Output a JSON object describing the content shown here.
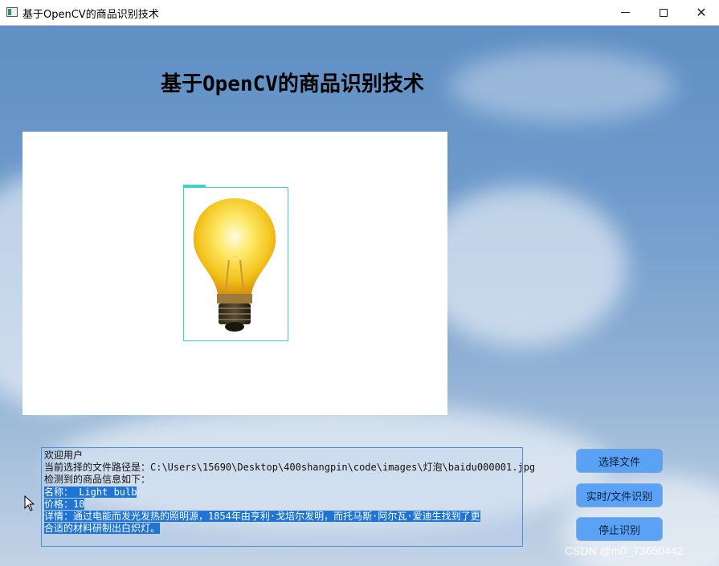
{
  "window": {
    "title": "基于OpenCV的商品识别技术",
    "minimize_label": "",
    "maximize_label": "",
    "close_label": "✕"
  },
  "page": {
    "heading": "基于OpenCV的商品识别技术"
  },
  "detection": {
    "label": "Light bulb",
    "box_color": "#3fd3c4"
  },
  "info": {
    "line1": "欢迎用户",
    "line2": "当前选择的文件路径是：C:\\Users\\15690\\Desktop\\400shangpin\\code\\images\\灯泡\\baidu000001.jpg",
    "line3": "检测到的商品信息如下：",
    "line4": "名称： Light bulb",
    "line5": "价格：10",
    "line6": "详情：通过电能而发光发热的照明源，1854年由亨利·戈培尔发明，而托马斯·阿尔瓦·爱迪生找到了更",
    "line7": "合适的材料研制出白炽灯。"
  },
  "buttons": {
    "select_file": "选择文件",
    "realtime_recognize": "实时/文件识别",
    "stop_recognize": "停止识别"
  },
  "watermark": "CSDN @m0_73650442",
  "colors": {
    "button_bg": "#5aa2f5",
    "selection_highlight": "#1f74d4",
    "info_border": "#4a90d9"
  }
}
